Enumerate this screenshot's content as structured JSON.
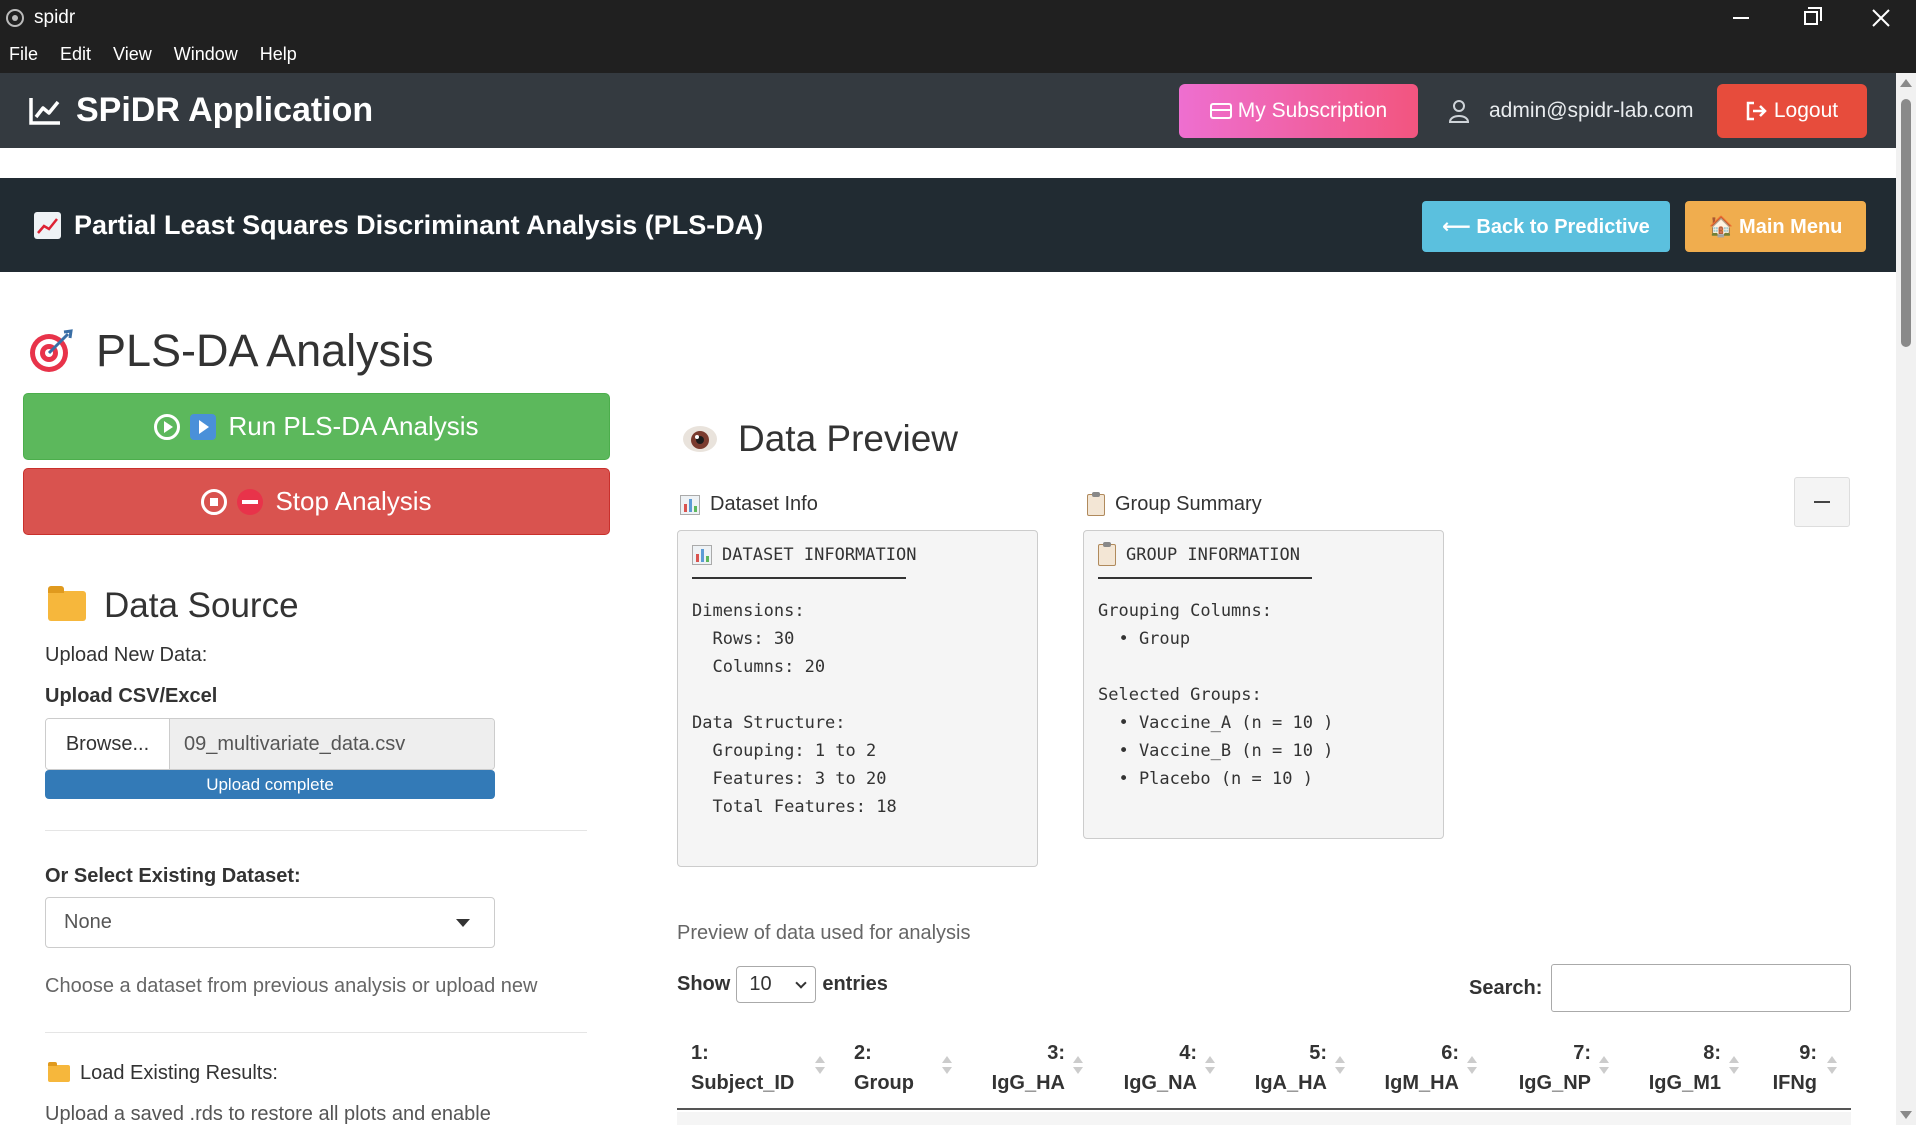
{
  "window": {
    "title": "spidr"
  },
  "menu": [
    "File",
    "Edit",
    "View",
    "Window",
    "Help"
  ],
  "header": {
    "brand": "SPiDR Application",
    "subscription_label": "My Subscription",
    "user_email": "admin@spidr-lab.com",
    "logout_label": "Logout"
  },
  "page": {
    "title": "Partial Least Squares Discriminant Analysis (PLS-DA)",
    "back_label": "⟵ Back to Predictive",
    "main_menu_label": "🏠 Main Menu"
  },
  "left": {
    "analysis_title": "PLS-DA Analysis",
    "run_label": "Run PLS-DA Analysis",
    "stop_label": "Stop Analysis",
    "data_source_title": "Data Source",
    "upload_new_label": "Upload New Data:",
    "upload_label": "Upload CSV/Excel",
    "browse_label": "Browse...",
    "file_name": "09_multivariate_data.csv",
    "upload_status": "Upload complete",
    "upload_progress": 1.0,
    "select_existing_label": "Or Select Existing Dataset:",
    "select_value": "None",
    "select_help": "Choose a dataset from previous analysis or upload new",
    "load_results_label": "Load Existing Results:",
    "load_results_help": "Upload a saved .rds to restore all plots and enable"
  },
  "right": {
    "preview_title": "Data Preview",
    "dataset_info_label": "Dataset Info",
    "group_summary_label": "Group Summary",
    "dataset_info": {
      "heading": "DATASET INFORMATION",
      "lines": [
        "Dimensions:",
        "  Rows: 30",
        "  Columns: 20",
        "",
        "Data Structure:",
        "  Grouping: 1 to 2",
        "  Features: 3 to 20",
        "  Total Features: 18"
      ]
    },
    "group_info": {
      "heading": "GROUP INFORMATION",
      "lines": [
        "Grouping Columns:",
        "  • Group",
        "",
        "Selected Groups:",
        "  • Vaccine_A (n = 10 )",
        "  • Vaccine_B (n = 10 )",
        "  • Placebo (n = 10 )"
      ]
    },
    "preview_caption": "Preview of data used for analysis",
    "show_label": "Show",
    "entries_value": "10",
    "entries_label": "entries",
    "search_label": "Search:",
    "columns": [
      {
        "num": "1:",
        "name": "Subject_ID"
      },
      {
        "num": "2:",
        "name": "Group"
      },
      {
        "num": "3:",
        "name": "IgG_HA"
      },
      {
        "num": "4:",
        "name": "IgG_NA"
      },
      {
        "num": "5:",
        "name": "IgA_HA"
      },
      {
        "num": "6:",
        "name": "IgM_HA"
      },
      {
        "num": "7:",
        "name": "IgG_NP"
      },
      {
        "num": "8:",
        "name": "IgG_M1"
      },
      {
        "num": "9:",
        "name": "IFNg"
      }
    ]
  },
  "colors": {
    "header_bg": "#343a40",
    "page_header_bg": "#212b32",
    "run_green": "#5cb85c",
    "stop_red": "#d9534f",
    "back_blue": "#5bc0de",
    "main_orange": "#f0ad4e",
    "logout_red": "#e74c3c",
    "progress_blue": "#337ab7"
  }
}
